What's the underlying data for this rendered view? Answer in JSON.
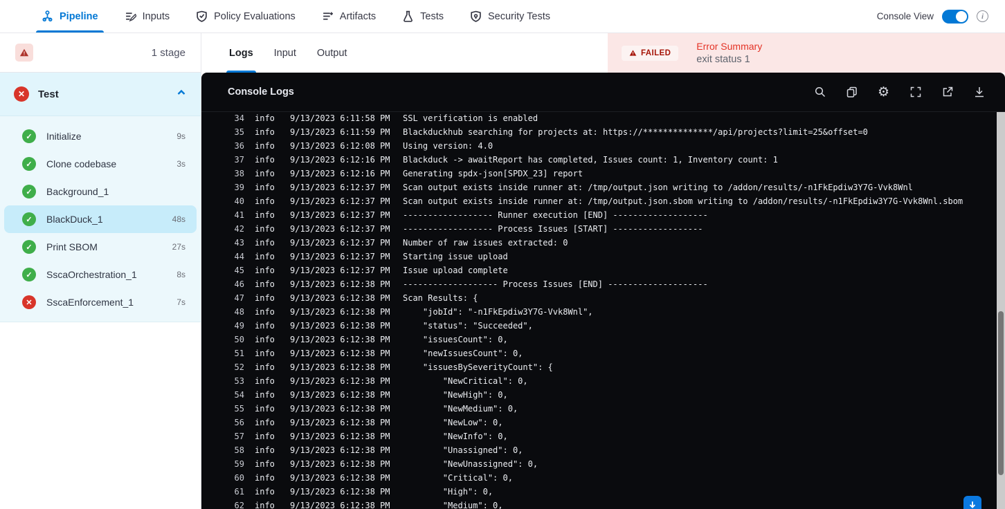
{
  "topnav": {
    "tabs": [
      {
        "label": "Pipeline",
        "icon": "pipeline-icon",
        "active": true
      },
      {
        "label": "Inputs",
        "icon": "inputs-icon",
        "active": false
      },
      {
        "label": "Policy Evaluations",
        "icon": "policy-evaluations-icon",
        "active": false
      },
      {
        "label": "Artifacts",
        "icon": "artifacts-icon",
        "active": false
      },
      {
        "label": "Tests",
        "icon": "tests-icon",
        "active": false
      },
      {
        "label": "Security Tests",
        "icon": "security-tests-icon",
        "active": false
      }
    ],
    "console_view_label": "Console View",
    "console_view_on": true
  },
  "sidebar": {
    "stage_count": "1 stage",
    "stage": {
      "name": "Test",
      "status": "failed"
    },
    "steps": [
      {
        "name": "Initialize",
        "duration": "9s",
        "status": "success",
        "selected": false
      },
      {
        "name": "Clone codebase",
        "duration": "3s",
        "status": "success",
        "selected": false
      },
      {
        "name": "Background_1",
        "duration": "",
        "status": "success",
        "selected": false
      },
      {
        "name": "BlackDuck_1",
        "duration": "48s",
        "status": "success",
        "selected": true
      },
      {
        "name": "Print SBOM",
        "duration": "27s",
        "status": "success",
        "selected": false
      },
      {
        "name": "SscaOrchestration_1",
        "duration": "8s",
        "status": "success",
        "selected": false
      },
      {
        "name": "SscaEnforcement_1",
        "duration": "7s",
        "status": "failed",
        "selected": false
      }
    ]
  },
  "main": {
    "tabs": [
      {
        "label": "Logs",
        "active": true
      },
      {
        "label": "Input",
        "active": false
      },
      {
        "label": "Output",
        "active": false
      }
    ],
    "error": {
      "badge": "FAILED",
      "title": "Error Summary",
      "message": "exit status 1"
    },
    "console": {
      "title": "Console Logs",
      "action_icons": [
        "search-icon",
        "copy-icon",
        "gear-icon",
        "fullscreen-icon",
        "open-in-new-icon",
        "download-icon"
      ],
      "logs": [
        {
          "n": 34,
          "level": "info",
          "ts": "9/13/2023 6:11:58 PM",
          "msg": "SSL verification is enabled"
        },
        {
          "n": 35,
          "level": "info",
          "ts": "9/13/2023 6:11:59 PM",
          "msg": "Blackduckhub searching for projects at: https://**************/api/projects?limit=25&offset=0"
        },
        {
          "n": 36,
          "level": "info",
          "ts": "9/13/2023 6:12:08 PM",
          "msg": "Using version: 4.0"
        },
        {
          "n": 37,
          "level": "info",
          "ts": "9/13/2023 6:12:16 PM",
          "msg": "Blackduck -> awaitReport has completed, Issues count: 1, Inventory count: 1"
        },
        {
          "n": 38,
          "level": "info",
          "ts": "9/13/2023 6:12:16 PM",
          "msg": "Generating spdx-json[SPDX_23] report"
        },
        {
          "n": 39,
          "level": "info",
          "ts": "9/13/2023 6:12:37 PM",
          "msg": "Scan output exists inside runner at: /tmp/output.json writing to /addon/results/-n1FkEpdiw3Y7G-Vvk8Wnl"
        },
        {
          "n": 40,
          "level": "info",
          "ts": "9/13/2023 6:12:37 PM",
          "msg": "Scan output exists inside runner at: /tmp/output.json.sbom writing to /addon/results/-n1FkEpdiw3Y7G-Vvk8Wnl.sbom"
        },
        {
          "n": 41,
          "level": "info",
          "ts": "9/13/2023 6:12:37 PM",
          "msg": "------------------ Runner execution [END] -------------------"
        },
        {
          "n": 42,
          "level": "info",
          "ts": "9/13/2023 6:12:37 PM",
          "msg": "------------------ Process Issues [START] ------------------"
        },
        {
          "n": 43,
          "level": "info",
          "ts": "9/13/2023 6:12:37 PM",
          "msg": "Number of raw issues extracted: 0"
        },
        {
          "n": 44,
          "level": "info",
          "ts": "9/13/2023 6:12:37 PM",
          "msg": "Starting issue upload"
        },
        {
          "n": 45,
          "level": "info",
          "ts": "9/13/2023 6:12:37 PM",
          "msg": "Issue upload complete"
        },
        {
          "n": 46,
          "level": "info",
          "ts": "9/13/2023 6:12:38 PM",
          "msg": "------------------- Process Issues [END] --------------------"
        },
        {
          "n": 47,
          "level": "info",
          "ts": "9/13/2023 6:12:38 PM",
          "msg": "Scan Results: {"
        },
        {
          "n": 48,
          "level": "info",
          "ts": "9/13/2023 6:12:38 PM",
          "msg": "    \"jobId\": \"-n1FkEpdiw3Y7G-Vvk8Wnl\","
        },
        {
          "n": 49,
          "level": "info",
          "ts": "9/13/2023 6:12:38 PM",
          "msg": "    \"status\": \"Succeeded\","
        },
        {
          "n": 50,
          "level": "info",
          "ts": "9/13/2023 6:12:38 PM",
          "msg": "    \"issuesCount\": 0,"
        },
        {
          "n": 51,
          "level": "info",
          "ts": "9/13/2023 6:12:38 PM",
          "msg": "    \"newIssuesCount\": 0,"
        },
        {
          "n": 52,
          "level": "info",
          "ts": "9/13/2023 6:12:38 PM",
          "msg": "    \"issuesBySeverityCount\": {"
        },
        {
          "n": 53,
          "level": "info",
          "ts": "9/13/2023 6:12:38 PM",
          "msg": "        \"NewCritical\": 0,"
        },
        {
          "n": 54,
          "level": "info",
          "ts": "9/13/2023 6:12:38 PM",
          "msg": "        \"NewHigh\": 0,"
        },
        {
          "n": 55,
          "level": "info",
          "ts": "9/13/2023 6:12:38 PM",
          "msg": "        \"NewMedium\": 0,"
        },
        {
          "n": 56,
          "level": "info",
          "ts": "9/13/2023 6:12:38 PM",
          "msg": "        \"NewLow\": 0,"
        },
        {
          "n": 57,
          "level": "info",
          "ts": "9/13/2023 6:12:38 PM",
          "msg": "        \"NewInfo\": 0,"
        },
        {
          "n": 58,
          "level": "info",
          "ts": "9/13/2023 6:12:38 PM",
          "msg": "        \"Unassigned\": 0,"
        },
        {
          "n": 59,
          "level": "info",
          "ts": "9/13/2023 6:12:38 PM",
          "msg": "        \"NewUnassigned\": 0,"
        },
        {
          "n": 60,
          "level": "info",
          "ts": "9/13/2023 6:12:38 PM",
          "msg": "        \"Critical\": 0,"
        },
        {
          "n": 61,
          "level": "info",
          "ts": "9/13/2023 6:12:38 PM",
          "msg": "        \"High\": 0,"
        },
        {
          "n": 62,
          "level": "info",
          "ts": "9/13/2023 6:12:38 PM",
          "msg": "        \"Medium\": 0,"
        }
      ]
    }
  },
  "colors": {
    "accent_blue": "#0278d5",
    "success_green": "#3fae4a",
    "failed_red": "#d8352a",
    "error_panel_bg": "#fbe7e6",
    "error_text_red": "#e43326",
    "selected_step_bg": "#c7ecfa",
    "console_bg": "#0a0b0e"
  }
}
